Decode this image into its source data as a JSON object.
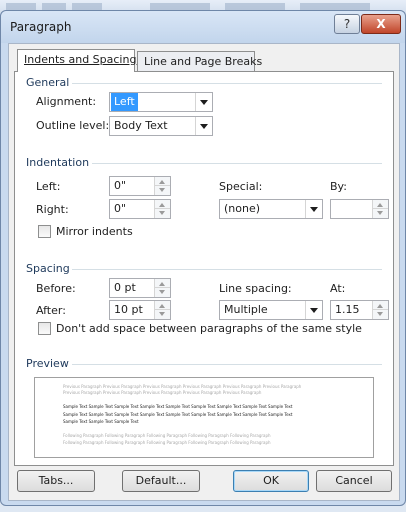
{
  "window": {
    "title": "Paragraph",
    "help_label": "?",
    "close_label": "X"
  },
  "tabs": [
    {
      "label": "Indents and Spacing",
      "active": true
    },
    {
      "label": "Line and Page Breaks",
      "active": false
    }
  ],
  "general": {
    "header": "General",
    "alignment_label": "Alignment:",
    "alignment_value": "Left",
    "outline_label": "Outline level:",
    "outline_value": "Body Text"
  },
  "indentation": {
    "header": "Indentation",
    "left_label": "Left:",
    "left_value": "0\"",
    "right_label": "Right:",
    "right_value": "0\"",
    "special_label": "Special:",
    "special_value": "(none)",
    "by_label": "By:",
    "by_value": "",
    "mirror_label": "Mirror indents",
    "mirror_checked": false
  },
  "spacing": {
    "header": "Spacing",
    "before_label": "Before:",
    "before_value": "0 pt",
    "after_label": "After:",
    "after_value": "10 pt",
    "line_spacing_label": "Line spacing:",
    "line_spacing_value": "Multiple",
    "at_label": "At:",
    "at_value": "1.15",
    "dont_add_label": "Don't add space between paragraphs of the same style",
    "dont_add_checked": false
  },
  "preview": {
    "header": "Preview",
    "previous_text": "Previous Paragraph Previous Paragraph Previous Paragraph Previous Paragraph Previous Paragraph Previous Paragraph",
    "previous_text2": "Previous Paragraph Previous Paragraph Previous Paragraph Previous Paragraph Previous Paragraph",
    "sample_text": "Sample Text Sample Text Sample Text Sample Text Sample Text Sample Text Sample Text Sample Text Sample Text",
    "sample_text2": "Sample Text Sample Text Sample Text Sample Text Sample Text Sample Text Sample Text Sample Text Sample Text",
    "sample_text3": "Sample Text Sample Text Sample Text",
    "following_text": "Following Paragraph Following Paragraph Following Paragraph Following Paragraph Following Paragraph",
    "following_text2": "Following Paragraph Following Paragraph Following Paragraph Following Paragraph Following Paragraph"
  },
  "buttons": {
    "tabs": "Tabs...",
    "default": "Default...",
    "ok": "OK",
    "cancel": "Cancel"
  }
}
